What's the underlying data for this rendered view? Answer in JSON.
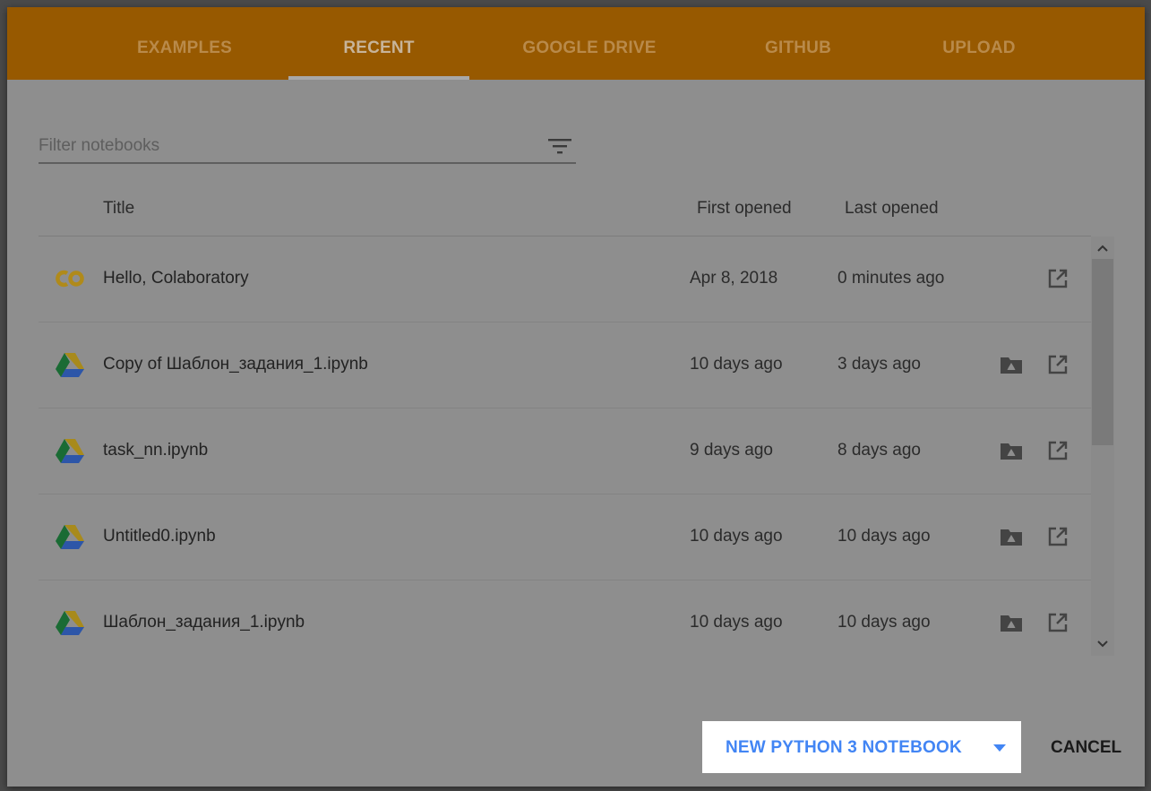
{
  "tabs": [
    {
      "label": "EXAMPLES"
    },
    {
      "label": "RECENT",
      "active": true
    },
    {
      "label": "GOOGLE DRIVE"
    },
    {
      "label": "GITHUB"
    },
    {
      "label": "UPLOAD"
    }
  ],
  "filter": {
    "placeholder": "Filter notebooks",
    "icon": "filter-list-icon"
  },
  "columns": {
    "title": "Title",
    "first_opened": "First opened",
    "last_opened": "Last opened"
  },
  "rows": [
    {
      "icon": "colab-icon",
      "title": "Hello, Colaboratory",
      "first_opened": "Apr 8, 2018",
      "last_opened": "0 minutes ago",
      "has_folder": false
    },
    {
      "icon": "google-drive-icon",
      "title": "Copy of Шаблон_задания_1.ipynb",
      "first_opened": "10 days ago",
      "last_opened": "3 days ago",
      "has_folder": true
    },
    {
      "icon": "google-drive-icon",
      "title": "task_nn.ipynb",
      "first_opened": "9 days ago",
      "last_opened": "8 days ago",
      "has_folder": true
    },
    {
      "icon": "google-drive-icon",
      "title": "Untitled0.ipynb",
      "first_opened": "10 days ago",
      "last_opened": "10 days ago",
      "has_folder": true
    },
    {
      "icon": "google-drive-icon",
      "title": "Шаблон_задания_1.ipynb",
      "first_opened": "10 days ago",
      "last_opened": "10 days ago",
      "has_folder": true
    }
  ],
  "actions": {
    "new_notebook": "NEW PYTHON 3 NOTEBOOK",
    "cancel": "CANCEL"
  },
  "colors": {
    "tab_bar": "#975900",
    "primary_action": "#4285f4",
    "overlay": "#8e8e8e"
  }
}
